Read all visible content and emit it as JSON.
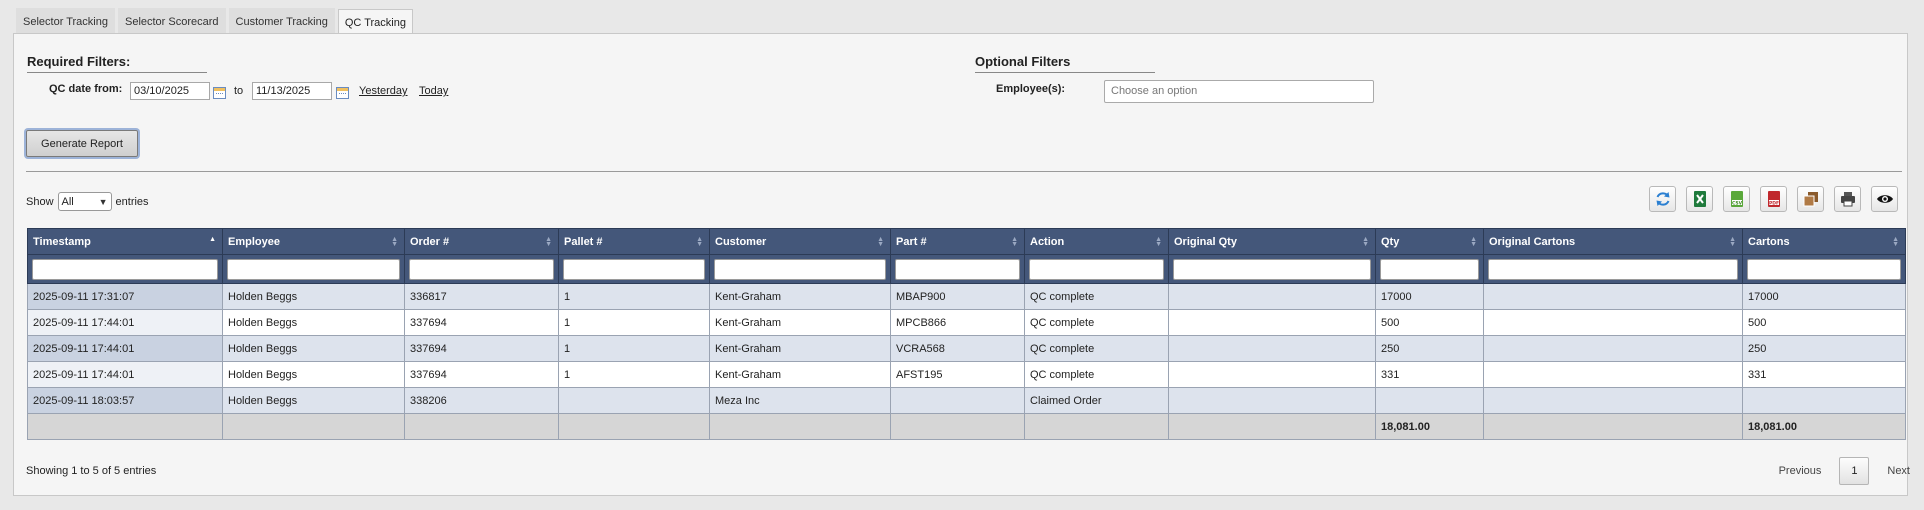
{
  "tabs": [
    {
      "label": "Selector Tracking",
      "active": false
    },
    {
      "label": "Selector Scorecard",
      "active": false
    },
    {
      "label": "Customer Tracking",
      "active": false
    },
    {
      "label": "QC Tracking",
      "active": true
    }
  ],
  "required_filters": {
    "title": "Required Filters:",
    "date_label": "QC date from:",
    "date_from": "03/10/2025",
    "to_label": "to",
    "date_to": "11/13/2025",
    "yesterday_link": "Yesterday",
    "today_link": "Today"
  },
  "optional_filters": {
    "title": "Optional Filters",
    "employee_label": "Employee(s):",
    "employee_placeholder": "Choose an option"
  },
  "generate_button": "Generate Report",
  "table_controls": {
    "show_label": "Show",
    "show_value": "All",
    "entries_label": "entries"
  },
  "toolbar_icons": [
    "refresh-icon",
    "excel-icon",
    "csv-icon",
    "pdf-icon",
    "copy-icon",
    "print-icon",
    "column-visibility-icon"
  ],
  "table": {
    "columns": [
      "Timestamp",
      "Employee",
      "Order #",
      "Pallet #",
      "Customer",
      "Part #",
      "Action",
      "Original Qty",
      "Qty",
      "Original Cartons",
      "Cartons"
    ],
    "rows": [
      [
        "2025-09-11 17:31:07",
        "Holden Beggs",
        "336817",
        "1",
        "Kent-Graham",
        "MBAP900",
        "QC complete",
        "",
        "17000",
        "",
        "17000"
      ],
      [
        "2025-09-11 17:44:01",
        "Holden Beggs",
        "337694",
        "1",
        "Kent-Graham",
        "MPCB866",
        "QC complete",
        "",
        "500",
        "",
        "500"
      ],
      [
        "2025-09-11 17:44:01",
        "Holden Beggs",
        "337694",
        "1",
        "Kent-Graham",
        "VCRA568",
        "QC complete",
        "",
        "250",
        "",
        "250"
      ],
      [
        "2025-09-11 17:44:01",
        "Holden Beggs",
        "337694",
        "1",
        "Kent-Graham",
        "AFST195",
        "QC complete",
        "",
        "331",
        "",
        "331"
      ],
      [
        "2025-09-11 18:03:57",
        "Holden Beggs",
        "338206",
        "",
        "Meza Inc",
        "",
        "Claimed Order",
        "",
        "",
        "",
        ""
      ]
    ],
    "totals": [
      "",
      "",
      "",
      "",
      "",
      "",
      "",
      "",
      "18,081.00",
      "",
      "18,081.00"
    ]
  },
  "footer": {
    "info": "Showing 1 to 5 of 5 entries",
    "previous": "Previous",
    "page": "1",
    "next": "Next"
  },
  "colors": {
    "header_bg": "#44577a",
    "row_odd": "#dde3ed",
    "row_even": "#ffffff",
    "total_row": "#d6d6d6"
  }
}
